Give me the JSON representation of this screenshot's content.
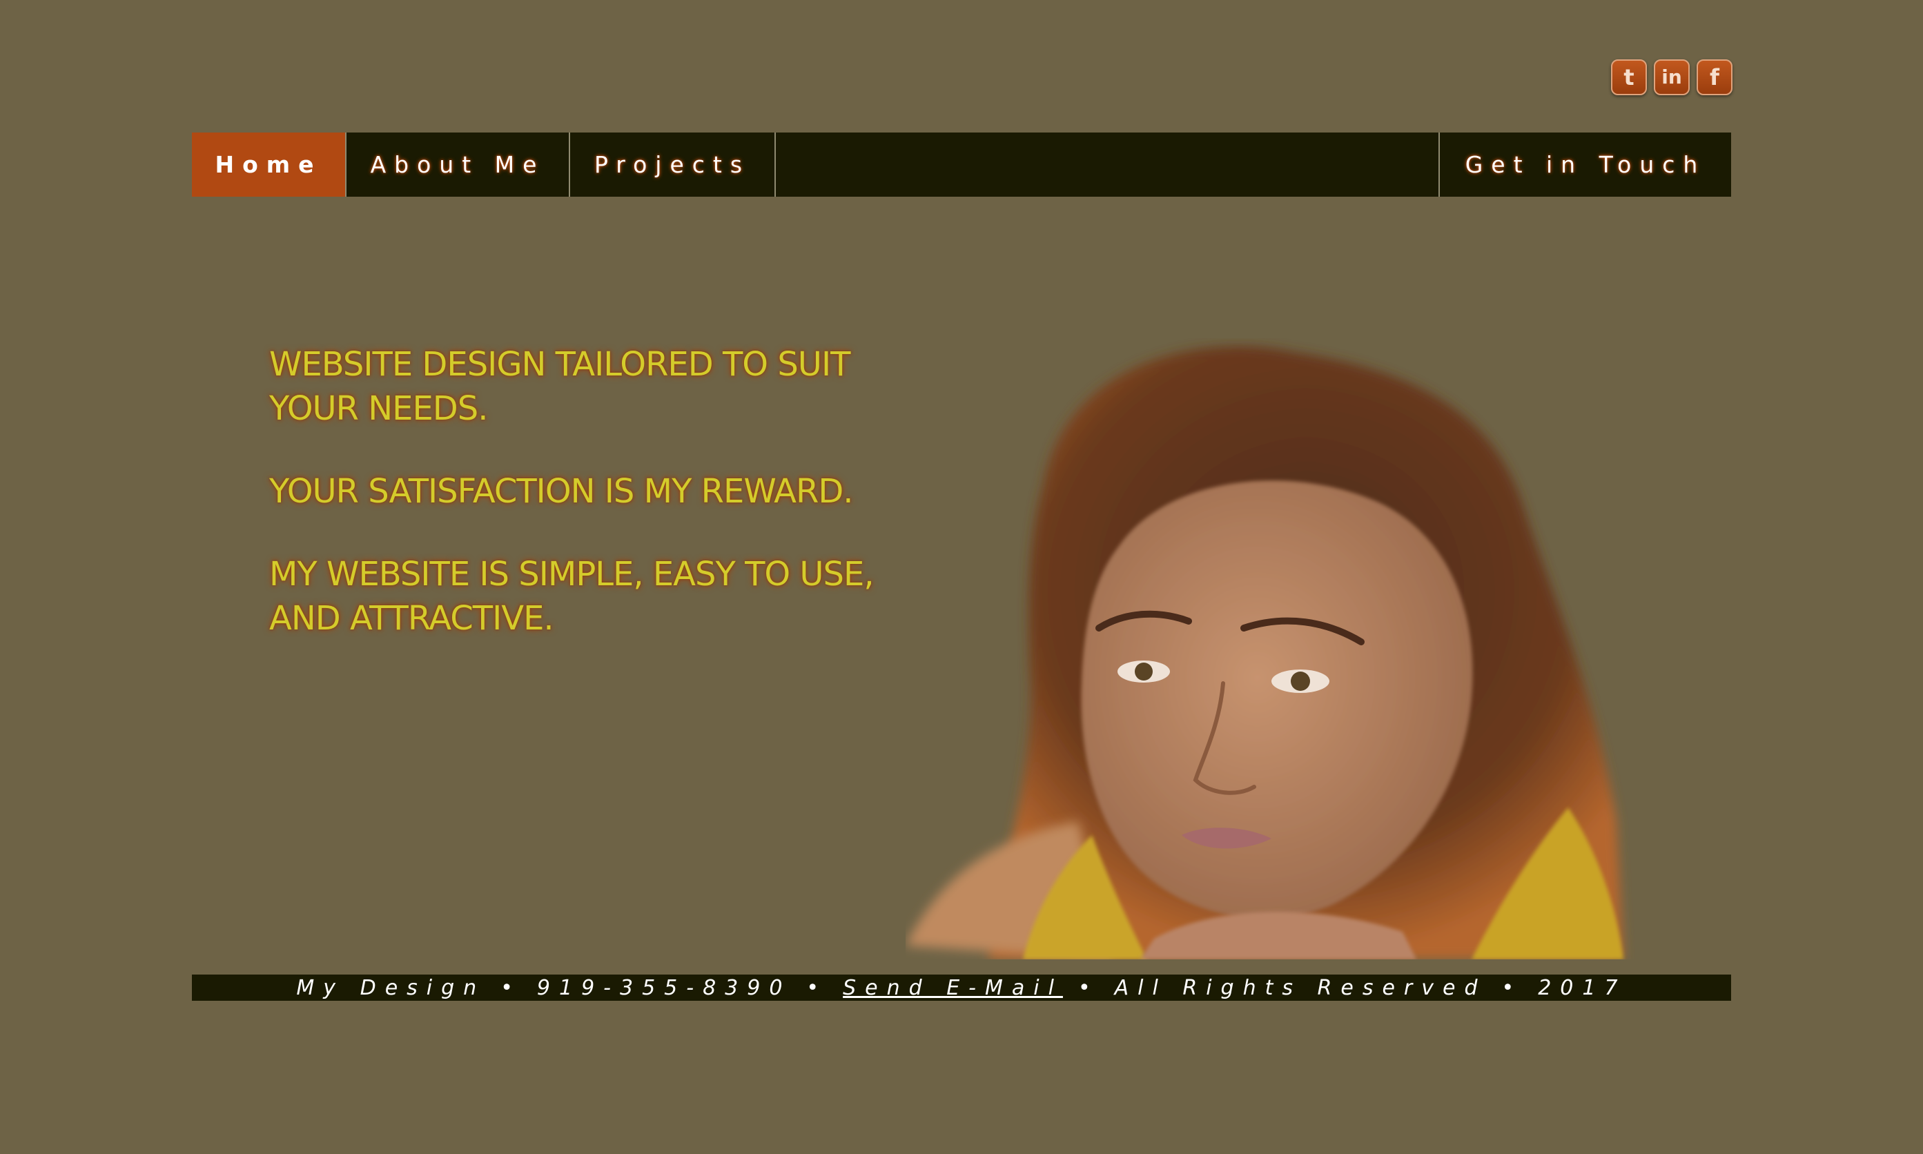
{
  "social": [
    {
      "label": "t",
      "icon": "tumblr-icon"
    },
    {
      "label": "in",
      "icon": "linkedin-icon"
    },
    {
      "label": "f",
      "icon": "facebook-icon"
    }
  ],
  "nav": {
    "home": "Home",
    "about": "About Me",
    "projects": "Projects",
    "contact": "Get in Touch"
  },
  "hero": {
    "line1": "WEBSITE DESIGN TAILORED TO SUIT YOUR NEEDS.",
    "line2": "YOUR SATISFACTION IS MY REWARD.",
    "line3": "MY WEBSITE IS SIMPLE, EASY TO USE, AND ATTRACTIVE."
  },
  "footer": {
    "name": "My Design",
    "separator": "•",
    "phone": "919-355-8390",
    "email_link": "Send E-Mail",
    "rights": "All Rights Reserved",
    "year": "2017"
  },
  "colors": {
    "background": "#6e6346",
    "nav_bar": "#1a1a02",
    "active_tab": "#b14912",
    "hero_text": "#d4cc2b",
    "social_icon": "#b14912"
  }
}
